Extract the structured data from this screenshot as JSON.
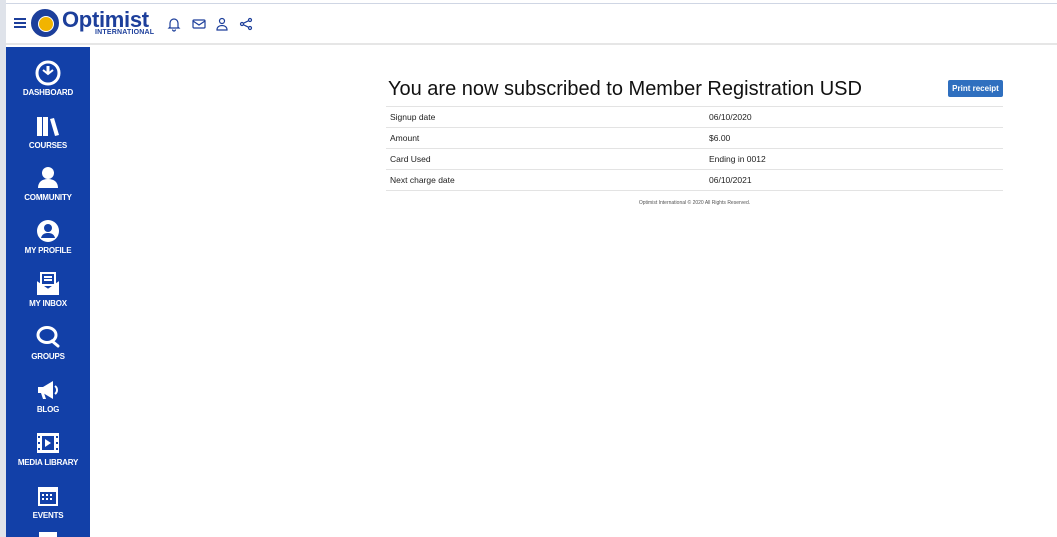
{
  "brand": {
    "name": "Optimist",
    "subtitle": "INTERNATIONAL",
    "color": "#1d3f9b",
    "accent": "#f2b400"
  },
  "topbar": {
    "icons": [
      "menu-icon",
      "bell-icon",
      "mail-icon",
      "user-icon",
      "share-icon"
    ]
  },
  "sidebar": {
    "bg_color": "#1240a8",
    "items": [
      {
        "label": "DASHBOARD",
        "icon": "dashboard-icon"
      },
      {
        "label": "COURSES",
        "icon": "books-icon"
      },
      {
        "label": "COMMUNITY",
        "icon": "community-icon"
      },
      {
        "label": "MY PROFILE",
        "icon": "profile-icon"
      },
      {
        "label": "MY INBOX",
        "icon": "inbox-icon"
      },
      {
        "label": "GROUPS",
        "icon": "chat-icon"
      },
      {
        "label": "BLOG",
        "icon": "megaphone-icon"
      },
      {
        "label": "MEDIA LIBRARY",
        "icon": "film-icon"
      },
      {
        "label": "EVENTS",
        "icon": "calendar-icon"
      }
    ]
  },
  "main": {
    "title": "You are now subscribed to Member Registration USD",
    "print_label": "Print receipt",
    "rows": [
      {
        "label": "Signup date",
        "value": "06/10/2020"
      },
      {
        "label": "Amount",
        "value": "$6.00"
      },
      {
        "label": "Card Used",
        "value": "Ending in 0012"
      },
      {
        "label": "Next charge date",
        "value": "06/10/2021"
      }
    ],
    "footer": "Optimist International © 2020 All Rights Reserved."
  }
}
